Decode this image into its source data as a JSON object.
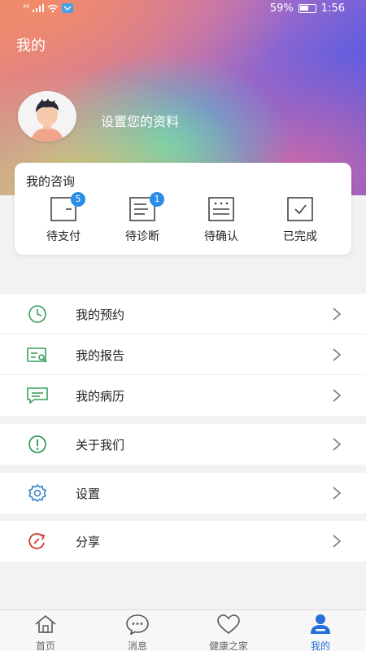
{
  "status": {
    "signal": "⁴⁶",
    "battery_percent": "59%",
    "battery_level": 0.59,
    "time": "1:56"
  },
  "header": {
    "title": "我的"
  },
  "profile": {
    "prompt": "设置您的资料"
  },
  "consult": {
    "title": "我的咨询",
    "items": [
      {
        "label": "待支付",
        "badge": "5",
        "icon": "pending-payment-icon"
      },
      {
        "label": "待诊断",
        "badge": "1",
        "icon": "pending-diagnosis-icon"
      },
      {
        "label": "待确认",
        "badge": "",
        "icon": "pending-confirm-icon"
      },
      {
        "label": "已完成",
        "badge": "",
        "icon": "completed-icon"
      }
    ]
  },
  "menu": {
    "group1": [
      {
        "label": "我的预约",
        "icon": "clock-icon"
      },
      {
        "label": "我的报告",
        "icon": "report-icon"
      },
      {
        "label": "我的病历",
        "icon": "medical-record-icon"
      }
    ],
    "about": {
      "label": "关于我们",
      "icon": "info-icon"
    },
    "settings": {
      "label": "设置",
      "icon": "gear-icon"
    },
    "share": {
      "label": "分享",
      "icon": "share-icon"
    }
  },
  "colors": {
    "accent": "#2a8de6",
    "active_tab": "#2a6fd6",
    "green_icon": "#3aa05a",
    "share_red": "#d33a2c",
    "settings_blue": "#2a7fc6"
  },
  "tabs": [
    {
      "label": "首页",
      "icon": "home-icon",
      "active": false
    },
    {
      "label": "消息",
      "icon": "message-icon",
      "active": false
    },
    {
      "label": "健康之家",
      "icon": "heart-icon",
      "active": false
    },
    {
      "label": "我的",
      "icon": "person-icon",
      "active": true
    }
  ]
}
